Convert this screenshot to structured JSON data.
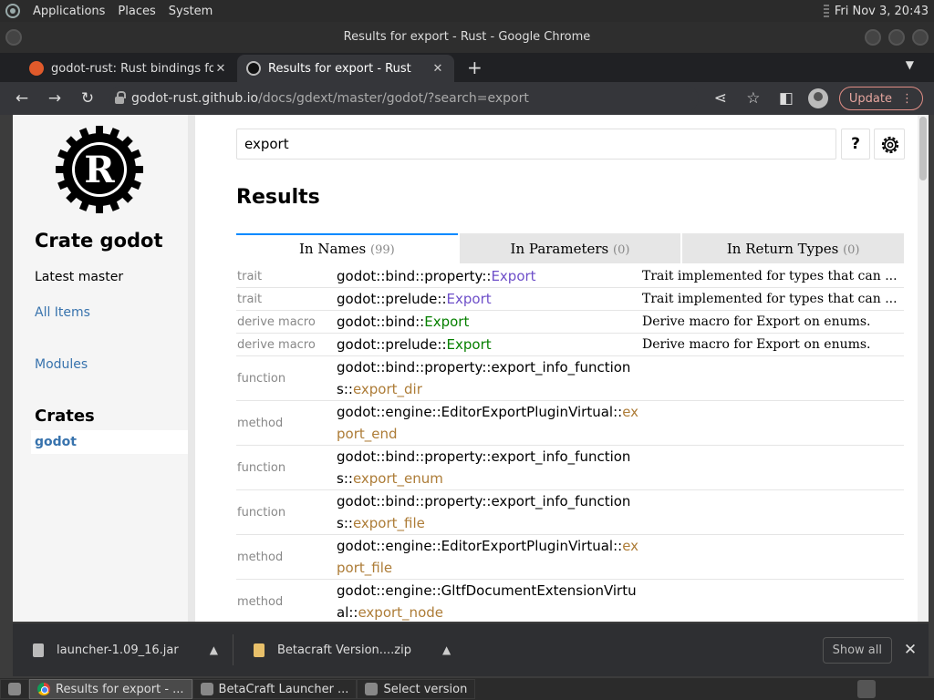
{
  "os": {
    "menu": [
      "Applications",
      "Places",
      "System"
    ],
    "clock": "Fri Nov  3, 20:43"
  },
  "window": {
    "title": "Results for export - Rust - Google Chrome"
  },
  "tabs": [
    {
      "label": "godot-rust: Rust bindings for the",
      "close": "✕"
    },
    {
      "label": "Results for export - Rust",
      "close": "✕"
    }
  ],
  "browser": {
    "new_tab": "+",
    "url_host": "godot-rust.github.io",
    "url_path": "/docs/gdext/master/godot/?search=export",
    "update_label": "Update"
  },
  "sidebar": {
    "crate_title": "Crate godot",
    "version": "Latest master",
    "all_items": "All Items",
    "modules": "Modules",
    "crates_heading": "Crates",
    "crate_link": "godot"
  },
  "search": {
    "value": "export",
    "help": "?"
  },
  "results": {
    "title": "Results",
    "tabs": [
      {
        "label": "In Names",
        "count": "(99)"
      },
      {
        "label": "In Parameters",
        "count": "(0)"
      },
      {
        "label": "In Return Types",
        "count": "(0)"
      }
    ],
    "rows": [
      {
        "kind": "trait",
        "prefix": "godot::bind::property::",
        "name": "Export",
        "desc": "Trait implemented for types that can ..."
      },
      {
        "kind": "trait",
        "prefix": "godot::prelude::",
        "name": "Export",
        "desc": "Trait implemented for types that can ..."
      },
      {
        "kind": "derive macro",
        "prefix": "godot::bind::",
        "name": "Export",
        "desc": "Derive macro for Export on enums."
      },
      {
        "kind": "derive macro",
        "prefix": "godot::prelude::",
        "name": "Export",
        "desc": "Derive macro for Export on enums."
      },
      {
        "kind": "function",
        "prefix": "godot::bind::property::export_info_functions::",
        "name": "export_dir",
        "desc": ""
      },
      {
        "kind": "method",
        "prefix": "godot::engine::EditorExportPluginVirtual::",
        "name": "export_end",
        "desc": ""
      },
      {
        "kind": "function",
        "prefix": "godot::bind::property::export_info_functions::",
        "name": "export_enum",
        "desc": ""
      },
      {
        "kind": "function",
        "prefix": "godot::bind::property::export_info_functions::",
        "name": "export_file",
        "desc": ""
      },
      {
        "kind": "method",
        "prefix": "godot::engine::EditorExportPluginVirtual::",
        "name": "export_file",
        "desc": ""
      },
      {
        "kind": "method",
        "prefix": "godot::engine::GltfDocumentExtensionVirtual::",
        "name": "export_node",
        "desc": ""
      }
    ]
  },
  "downloads": {
    "items": [
      {
        "name": "launcher-1.09_16.jar",
        "icon": "file-icon"
      },
      {
        "name": "Betacraft Version....zip",
        "icon": "zip-icon"
      }
    ],
    "show_all": "Show all",
    "close": "✕"
  },
  "taskbar": {
    "items": [
      {
        "label": "Results for export - ..."
      },
      {
        "label": "BetaCraft Launcher ..."
      },
      {
        "label": "Select version"
      }
    ]
  },
  "colors": {
    "trait": "#6e4fc9",
    "macro": "#068000",
    "function": "#ad7c37",
    "link": "#3873ad",
    "active_tab": "#0089ff"
  }
}
